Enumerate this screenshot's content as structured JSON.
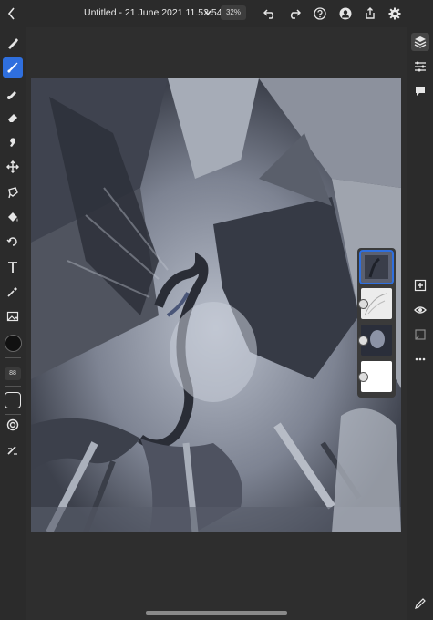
{
  "header": {
    "back_icon": "chevron-left-icon",
    "title": "Untitled - 21 June 2021 11.52.54 *",
    "zoom": "32%",
    "actions": [
      "undo-icon",
      "redo-icon",
      "help-icon",
      "account-icon",
      "share-icon",
      "settings-icon"
    ]
  },
  "left_toolbar": {
    "tools": [
      "pixel-brush-icon",
      "live-brush-icon",
      "fill-brush-icon",
      "eraser-icon",
      "smudge-icon",
      "move-icon",
      "lasso-icon",
      "paint-bucket-icon",
      "transform-icon",
      "text-icon",
      "eyedropper-icon",
      "image-icon"
    ],
    "active_tool": "live-brush-icon",
    "brush_size": "88",
    "current_color": "#111111"
  },
  "right_toolbar": {
    "tools": [
      "layers-icon",
      "layer-properties-icon",
      "comments-icon"
    ],
    "layer_actions": [
      "add-layer-icon",
      "visibility-icon",
      "mask-icon",
      "more-icon"
    ],
    "bottom": "pencil-icon"
  },
  "layers_panel": {
    "layers": [
      {
        "name": "layer-1",
        "active": true
      },
      {
        "name": "layer-2",
        "active": false
      },
      {
        "name": "layer-3",
        "active": false
      },
      {
        "name": "layer-4",
        "active": false
      }
    ]
  },
  "colors": {
    "accent": "#2f6fde",
    "background": "#2b2b2b"
  }
}
